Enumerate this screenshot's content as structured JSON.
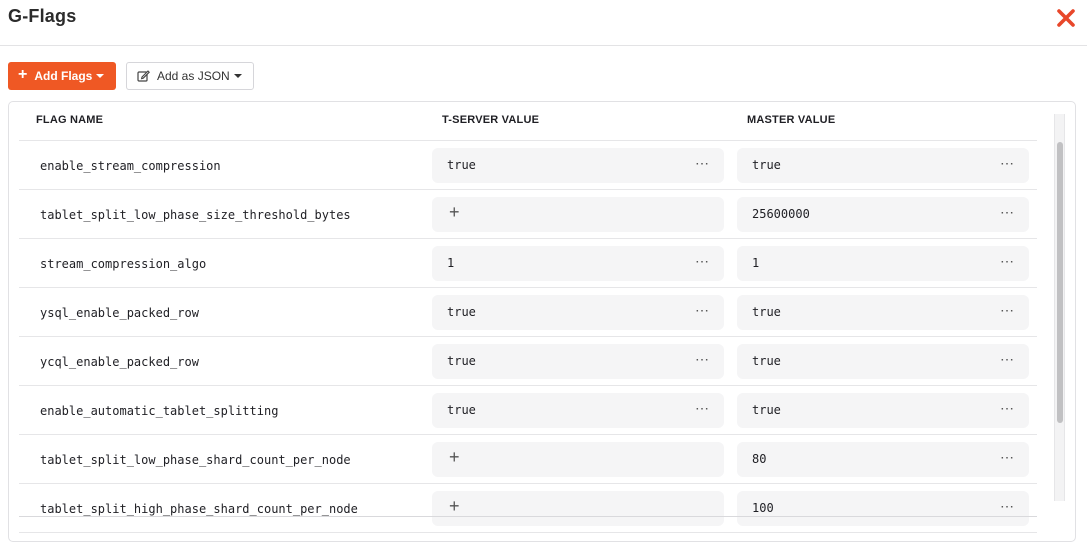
{
  "dialog": {
    "title": "G-Flags"
  },
  "toolbar": {
    "add_flags_label": "Add Flags",
    "add_json_label": "Add as JSON"
  },
  "colors": {
    "accent": "#ef5824",
    "close": "#e8472a"
  },
  "table": {
    "headers": {
      "flag_name": "FLAG NAME",
      "tserver_value": "T-SERVER VALUE",
      "master_value": "MASTER VALUE"
    },
    "rows": [
      {
        "name": "enable_stream_compression",
        "tserver": "true",
        "master": "true"
      },
      {
        "name": "tablet_split_low_phase_size_threshold_bytes",
        "tserver": "",
        "master": "25600000"
      },
      {
        "name": "stream_compression_algo",
        "tserver": "1",
        "master": "1"
      },
      {
        "name": "ysql_enable_packed_row",
        "tserver": "true",
        "master": "true"
      },
      {
        "name": "ycql_enable_packed_row",
        "tserver": "true",
        "master": "true"
      },
      {
        "name": "enable_automatic_tablet_splitting",
        "tserver": "true",
        "master": "true"
      },
      {
        "name": "tablet_split_low_phase_shard_count_per_node",
        "tserver": "",
        "master": "80"
      },
      {
        "name": "tablet_split_high_phase_shard_count_per_node",
        "tserver": "",
        "master": "100"
      }
    ]
  },
  "icons": {
    "close": "close-icon",
    "plus": "plus-icon",
    "edit": "edit-icon",
    "more": "more-icon"
  }
}
